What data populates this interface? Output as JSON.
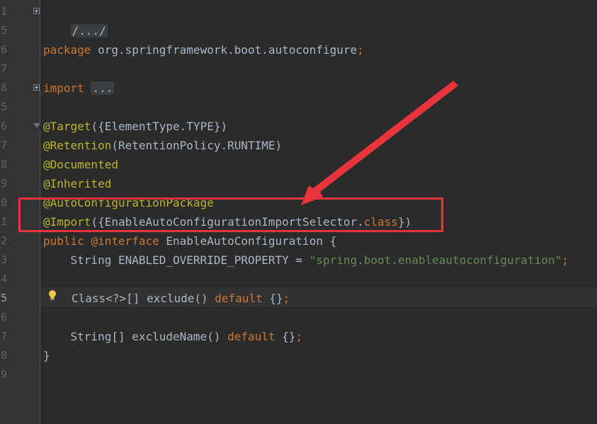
{
  "editor": {
    "gutter_numbers": [
      "1",
      "5",
      "6",
      "7",
      "8",
      "5",
      "6",
      "7",
      "8",
      "9",
      "0",
      "1",
      "2",
      "3",
      "4",
      "5",
      "6",
      "7",
      "8",
      "9"
    ],
    "current_line_number": "5"
  },
  "code": {
    "header_comment": "/.../",
    "package_kw": "package",
    "package_name": " org.springframework.boot.autoconfigure",
    "package_semicolon": ";",
    "import_kw": "import",
    "import_folded": "...",
    "target_ann": "@Target",
    "target_args": "({ElementType.TYPE})",
    "retention_ann": "@Retention",
    "retention_args": "(RetentionPolicy.RUNTIME)",
    "documented_ann": "@Documented",
    "inherited_ann": "@Inherited",
    "autoconfigpkg_ann": "@AutoConfigurationPackage",
    "import_ann": "@Import",
    "import_args_open": "({EnableAutoConfigurationImportSelector.",
    "import_args_class_kw": "class",
    "import_args_close": "})",
    "public_kw": "public",
    "interface_kw": "@interface",
    "interface_name": " EnableAutoConfiguration {",
    "field_type": "    String ENABLED_OVERRIDE_PROPERTY = ",
    "field_value": "\"spring.boot.enableautoconfiguration\"",
    "field_semicolon": ";",
    "exclude_sig": "Class<?>[] exclude() ",
    "exclude_default_kw": "default",
    "exclude_body": " {}",
    "exclude_semicolon": ";",
    "exclude_name_sig": "    String[] excludeName() ",
    "exclude_name_default_kw": "default",
    "exclude_name_body": " {}",
    "exclude_name_semicolon": ";",
    "closing_brace": "}"
  },
  "colors": {
    "background": "#2b2b2b",
    "keyword": "#cc7832",
    "string": "#6a8759",
    "annotation": "#bbb529",
    "text": "#a9b7c6",
    "highlight_box": "#e8343b",
    "arrow": "#e8343b"
  },
  "icons": {
    "intention_bulb": "lightbulb-icon",
    "fold_markers": "fold-toggle-icon"
  }
}
